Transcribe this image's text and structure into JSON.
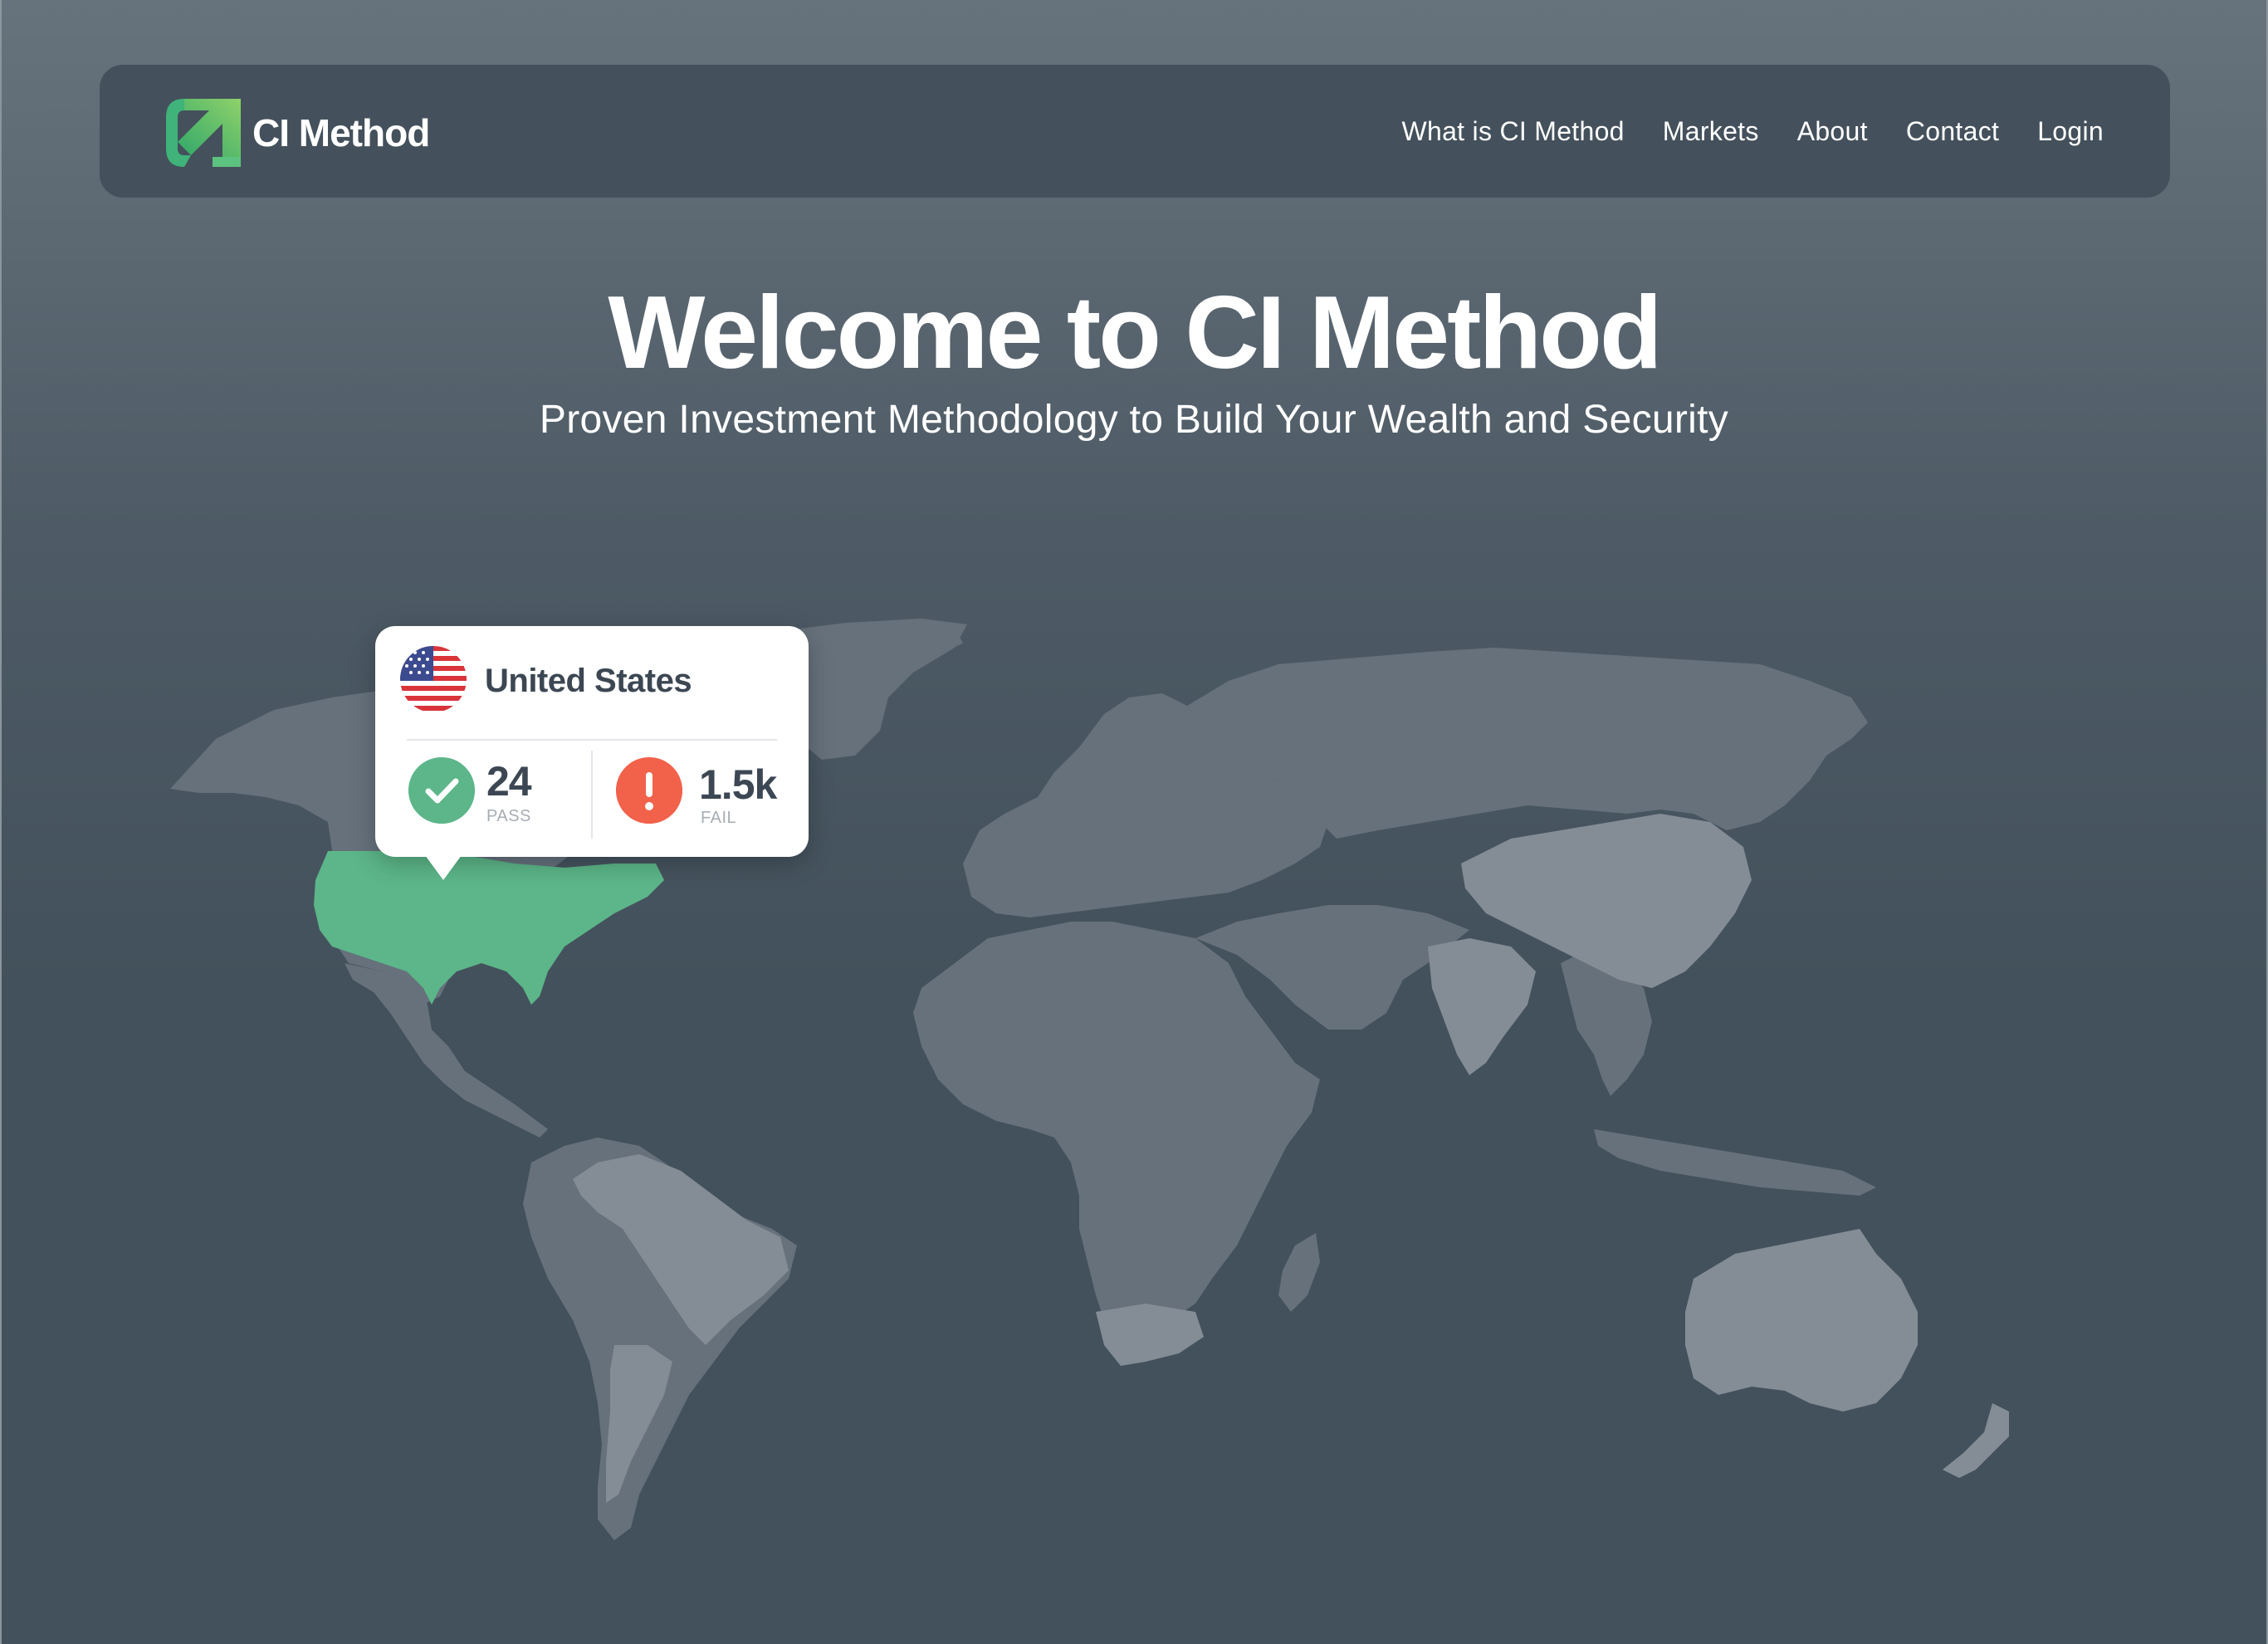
{
  "app": {
    "brand": "CI Method",
    "colors": {
      "brand_green": "#5cb689",
      "fail_red": "#f2614a",
      "nav_bg": "#44515c",
      "land_light": "#848d96",
      "land_dark": "#66717c",
      "highlight_green": "#5cb689"
    }
  },
  "nav": {
    "links": [
      {
        "label": "What is CI Method"
      },
      {
        "label": "Markets"
      },
      {
        "label": "About"
      },
      {
        "label": "Contact"
      },
      {
        "label": "Login"
      }
    ]
  },
  "hero": {
    "title": "Welcome to CI Method",
    "subtitle": "Proven Investment Methodology to Build Your Wealth and Security"
  },
  "map": {
    "highlighted_country": "United States",
    "popup": {
      "country": "United States",
      "flag_icon": "us-flag-icon",
      "pass": {
        "value": "24",
        "label": "PASS",
        "icon": "check-icon"
      },
      "fail": {
        "value": "1.5k",
        "label": "FAIL",
        "icon": "alert-icon"
      }
    }
  }
}
